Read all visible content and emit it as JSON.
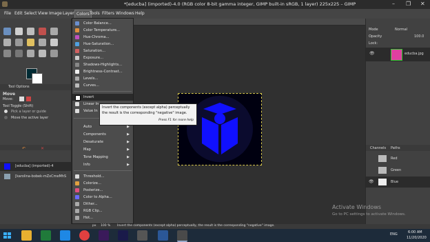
{
  "window": {
    "title": "*[educba] (imported)-4.0 (RGB color 8-bit gamma integer, GIMP built-in sRGB, 1 layer) 225x225 – GIMP",
    "controls": [
      "–",
      "❐",
      "✕"
    ]
  },
  "menubar": [
    "File",
    "Edit",
    "Select",
    "View",
    "Image",
    "Layer",
    "Colors",
    "Tools",
    "Filters",
    "Windows",
    "Help"
  ],
  "colors_menu": {
    "group1": [
      "Color Balance...",
      "Color Temperature...",
      "Hue-Chroma...",
      "Hue-Saturation...",
      "Saturation...",
      "Exposure...",
      "Shadows-Highlights...",
      "Brightness-Contrast...",
      "Levels...",
      "Curves..."
    ],
    "group2": [
      "Invert",
      "Linear Invert",
      "Value Invert"
    ],
    "group2_visible": [
      "Invert",
      "Linear In",
      "Value In"
    ],
    "group3": [
      "Auto",
      "Components",
      "Desaturate",
      "Map",
      "Tone Mapping",
      "Info"
    ],
    "group4": [
      "Threshold...",
      "Colorize...",
      "Posterize...",
      "Color to Alpha...",
      "Dither...",
      "RGB Clip...",
      "Hot..."
    ]
  },
  "tooltip": {
    "line1": "Invert the components (except alpha) perceptually",
    "line2": "the result is the corresponding \"negative\" image.",
    "hint": "Press F1 for more help"
  },
  "tool_options": {
    "tab": "Tool Options",
    "title": "Move",
    "move_label": "Move:",
    "toggle": "Tool Toggle  (Shift)",
    "opt1": "Pick a layer or guide",
    "opt2": "Move the active layer"
  },
  "images": {
    "item1": "[educba] (imported)-4",
    "item2": "[karolina-bobek-mZxCmeMhS"
  },
  "layers": {
    "mode_label": "Mode",
    "mode_value": "Normal",
    "opacity_label": "Opacity",
    "opacity_value": "100.0",
    "lock_label": "Lock:",
    "layer_name": "educba.jpg"
  },
  "channels": {
    "tab1": "Channels",
    "tab2": "Paths",
    "items": [
      "Red",
      "Green",
      "Blue"
    ]
  },
  "status": {
    "unit": "px",
    "zoom": "100 %",
    "message": "Invert the components (except alpha) perceptually, the result is the corresponding \"negative\" image."
  },
  "watermark": {
    "line1": "Activate Windows",
    "line2": "Go to PC settings to activate Windows."
  },
  "taskbar": {
    "lang": "ENG",
    "time": "6:00 AM",
    "date": "11/20/2020"
  },
  "colors": {
    "menu_bg": "#4c4c4c",
    "highlight": "#2a2a2a",
    "image_blue": "#1010ff"
  }
}
